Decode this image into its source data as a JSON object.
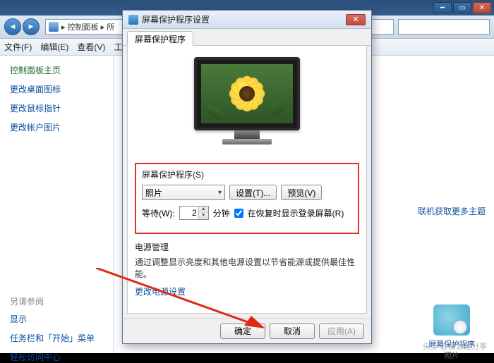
{
  "bgwin": {
    "breadcrumb_root": "控制面板",
    "breadcrumb_sep": "▸",
    "breadcrumb_next": "所",
    "menu": {
      "file": "文件(F)",
      "edit": "编辑(E)",
      "view": "查看(V)",
      "tools": "工具"
    }
  },
  "sidebar": {
    "home": "控制面板主页",
    "links": [
      "更改桌面图标",
      "更改鼠标指针",
      "更改帐户图片"
    ],
    "also_label": "另请参阅",
    "also": [
      "显示",
      "任务栏和「开始」菜单",
      "轻松访问中心"
    ]
  },
  "right": {
    "more_themes": "联机获取更多主题",
    "caption": "屏幕保护程序",
    "sub": "照片"
  },
  "dialog": {
    "title": "屏幕保护程序设置",
    "tab": "屏幕保护程序",
    "group_label": "屏幕保护程序(S)",
    "dropdown_value": "照片",
    "settings_btn": "设置(T)...",
    "preview_btn": "预览(V)",
    "wait_label": "等待(W):",
    "wait_value": "2",
    "wait_unit": "分钟",
    "resume_label": "在恢复时显示登录屏幕(R)",
    "power_label": "电源管理",
    "power_desc": "通过调整显示亮度和其他电源设置以节省能源或提供最佳性能。",
    "power_link": "更改电源设置",
    "ok": "确定",
    "cancel": "取消",
    "apply": "应用(A)"
  },
  "attrib": "头条 @资源趣分享"
}
